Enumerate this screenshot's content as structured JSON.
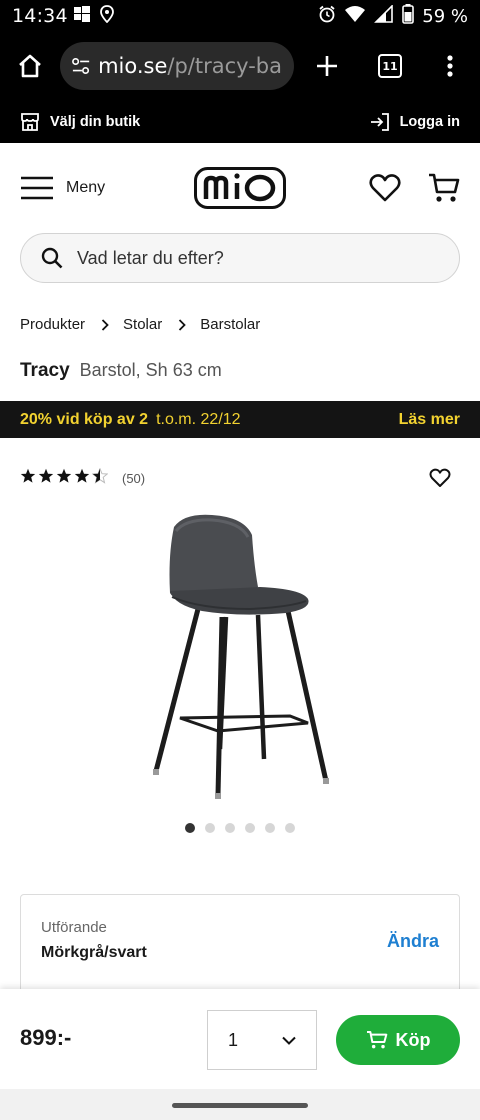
{
  "status_bar": {
    "time": "14:34",
    "battery_percent": "59 %",
    "icons": [
      "windows-icon",
      "location-icon",
      "alarm-icon",
      "wifi-icon",
      "signal-icon",
      "battery-icon"
    ]
  },
  "browser": {
    "url_host": "mio.se",
    "url_path": "/p/tracy-ba",
    "tab_count": "11"
  },
  "store_bar": {
    "store_label": "Välj din butik",
    "login_label": "Logga in"
  },
  "header": {
    "menu_label": "Meny",
    "logo_text": "mio"
  },
  "search": {
    "placeholder": "Vad letar du efter?"
  },
  "breadcrumb": [
    "Produkter",
    "Stolar",
    "Barstolar"
  ],
  "product": {
    "name": "Tracy",
    "description": "Barstol, Sh 63 cm",
    "rating_value": 4.5,
    "rating_max": 5,
    "review_count": "(50)",
    "image_count": 6,
    "active_image_index": 0
  },
  "promo": {
    "main": "20% vid köp av 2",
    "until": "t.o.m. 22/12",
    "link": "Läs mer",
    "color": "#f2d230"
  },
  "variant": {
    "label": "Utförande",
    "value": "Mörkgrå/svart",
    "change_label": "Ändra"
  },
  "purchase": {
    "price": "899:-",
    "quantity": "1",
    "buy_label": "Köp",
    "buy_color": "#1fad3a"
  }
}
